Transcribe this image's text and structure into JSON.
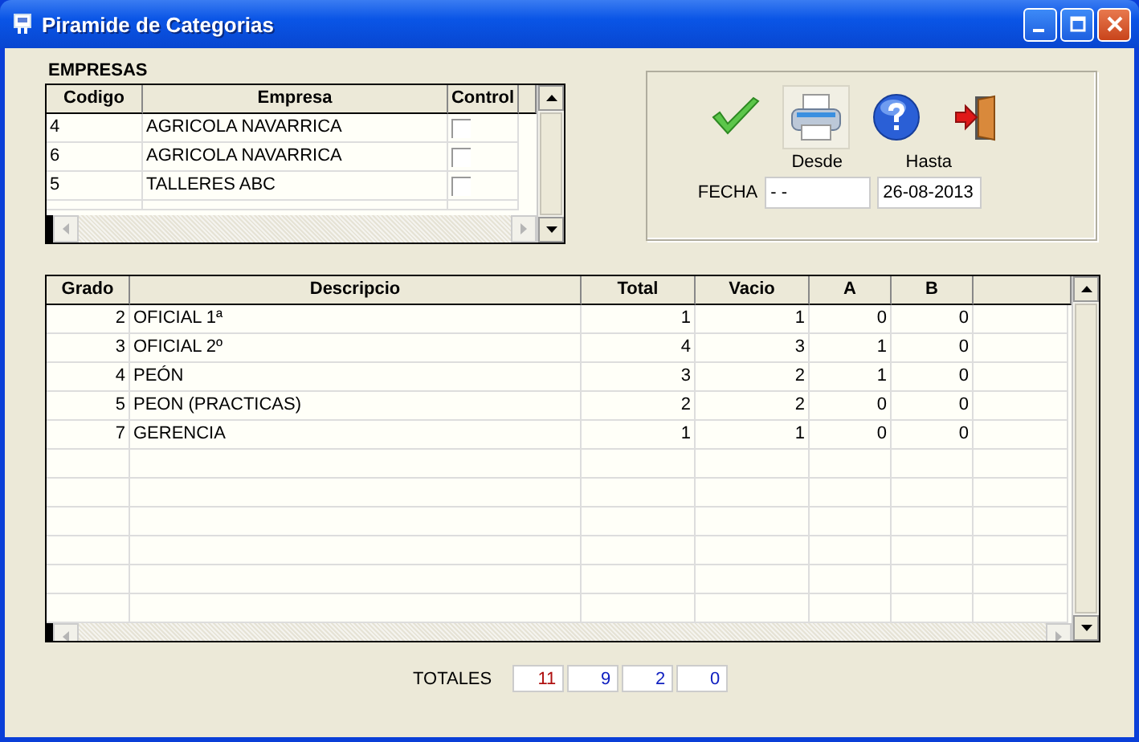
{
  "window": {
    "title": "Piramide de Categorias"
  },
  "empresas": {
    "label": "EMPRESAS",
    "columns": [
      "Codigo",
      "Empresa",
      "Control"
    ],
    "rows": [
      {
        "codigo": "4",
        "empresa": "AGRICOLA NAVARRICA",
        "checked": false
      },
      {
        "codigo": "6",
        "empresa": "AGRICOLA NAVARRICA",
        "checked": false
      },
      {
        "codigo": "5",
        "empresa": "TALLERES ABC",
        "checked": false
      }
    ]
  },
  "fecha": {
    "label": "FECHA",
    "desde_label": "Desde",
    "hasta_label": "Hasta",
    "desde": "- -",
    "hasta": "26-08-2013"
  },
  "table": {
    "columns": [
      "Grado",
      "Descripcio",
      "Total",
      "Vacio",
      "A",
      "B"
    ],
    "rows": [
      [
        "2",
        "OFICIAL 1ª",
        "1",
        "1",
        "0",
        "0"
      ],
      [
        "3",
        "OFICIAL 2º",
        "4",
        "3",
        "1",
        "0"
      ],
      [
        "4",
        "PEÓN",
        "3",
        "2",
        "1",
        "0"
      ],
      [
        "5",
        "PEON (PRACTICAS)",
        "2",
        "2",
        "0",
        "0"
      ],
      [
        "7",
        "GERENCIA",
        "1",
        "1",
        "0",
        "0"
      ]
    ]
  },
  "totales": {
    "label": "TOTALES",
    "values": [
      {
        "value": "11",
        "color": "#b01010"
      },
      {
        "value": "9",
        "color": "#1020c0"
      },
      {
        "value": "2",
        "color": "#1020c0"
      },
      {
        "value": "0",
        "color": "#1020c0"
      }
    ]
  }
}
